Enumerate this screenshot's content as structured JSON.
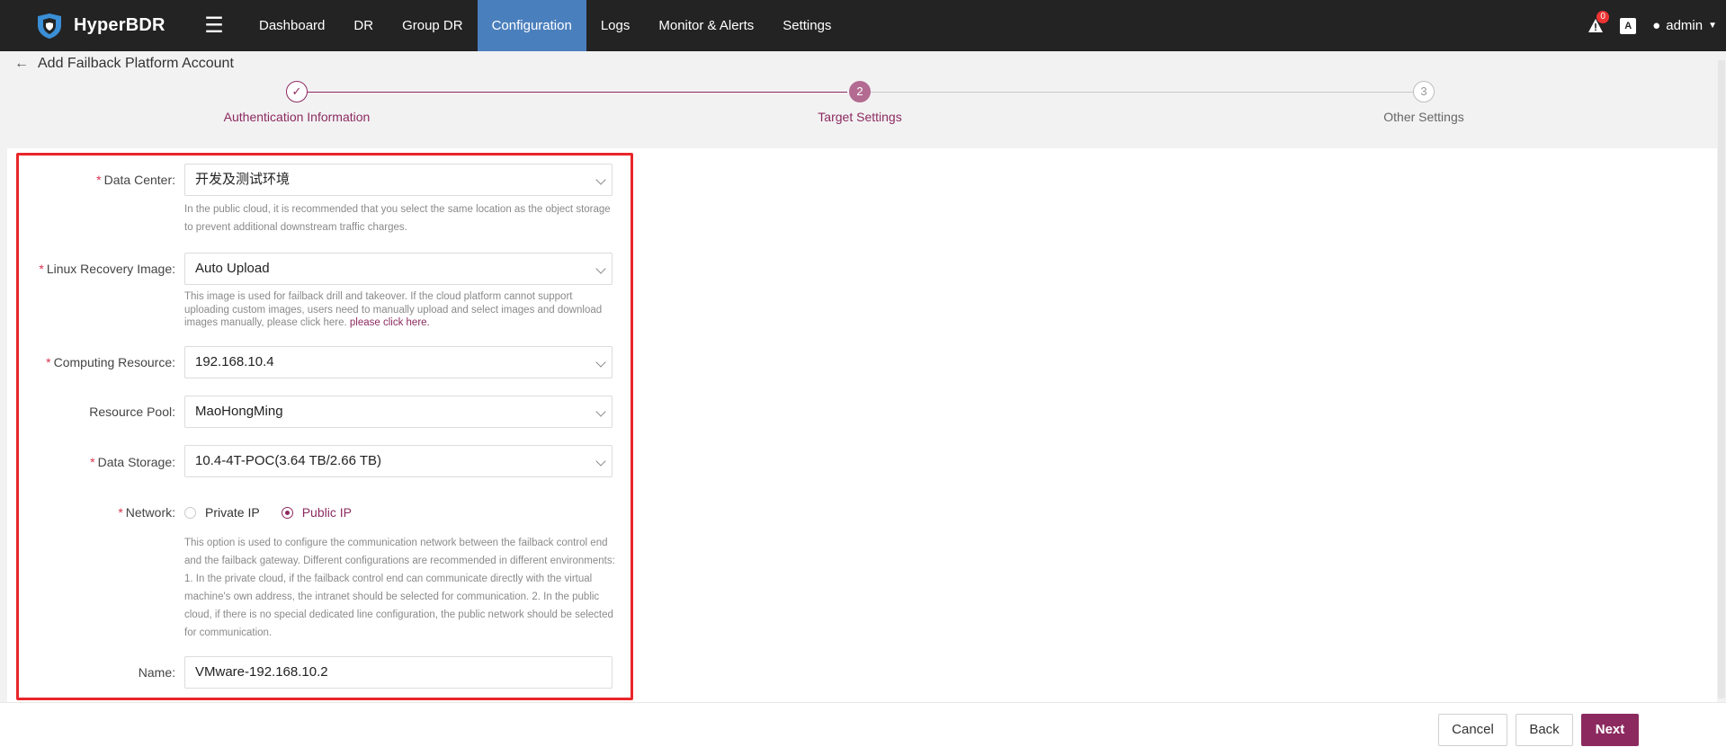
{
  "app": {
    "logo_text": "HyperBDR",
    "logo_icon": "shield-logo-icon",
    "menu_icon": "hamburger-icon"
  },
  "nav": {
    "items": [
      {
        "label": "Dashboard"
      },
      {
        "label": "DR"
      },
      {
        "label": "Group DR"
      },
      {
        "label": "Configuration",
        "active": true
      },
      {
        "label": "Logs"
      },
      {
        "label": "Monitor & Alerts"
      },
      {
        "label": "Settings"
      }
    ],
    "alerts_count": "0",
    "lang_icon_text": "A",
    "user": "admin"
  },
  "page": {
    "title": "Add Failback Platform Account"
  },
  "steps": [
    {
      "index": "1",
      "label": "Authentication Information",
      "state": "done"
    },
    {
      "index": "2",
      "label": "Target Settings",
      "state": "current"
    },
    {
      "index": "3",
      "label": "Other Settings",
      "state": "todo"
    }
  ],
  "form": {
    "data_center": {
      "label": "Data Center:",
      "required": true,
      "value": "开发及测试环境",
      "hint": "In the public cloud, it is recommended that you select the same location as the object storage to prevent additional downstream traffic charges."
    },
    "linux_image": {
      "label": "Linux Recovery Image:",
      "required": true,
      "value": "Auto Upload",
      "hint": "This image is used for failback drill and takeover. If the cloud platform cannot support uploading custom images, users need to manually upload and select images and download images manually, please click here.",
      "hint_link": "please click here."
    },
    "computing_resource": {
      "label": "Computing Resource:",
      "required": true,
      "value": "192.168.10.4"
    },
    "resource_pool": {
      "label": "Resource Pool:",
      "required": false,
      "value": "MaoHongMing"
    },
    "data_storage": {
      "label": "Data Storage:",
      "required": true,
      "value": "10.4-4T-POC(3.64 TB/2.66 TB)"
    },
    "network": {
      "label": "Network:",
      "required": true,
      "options": [
        {
          "label": "Private IP",
          "checked": false
        },
        {
          "label": "Public IP",
          "checked": true
        }
      ],
      "hint": "This option is used to configure the communication network between the failback control end and the failback gateway. Different configurations are recommended in different environments: 1. In the private cloud, if the failback control end can communicate directly with the virtual machine's own address, the intranet should be selected for communication. 2. In the public cloud, if there is no special dedicated line configuration, the public network should be selected for communication."
    },
    "name": {
      "label": "Name:",
      "required": false,
      "value": "VMware-192.168.10.2"
    }
  },
  "footer": {
    "cancel": "Cancel",
    "back": "Back",
    "next": "Next"
  },
  "colors": {
    "accent": "#8c2a5f",
    "nav_active": "#4a7fbd",
    "topbar": "#232323",
    "highlight_box": "#e8262a"
  }
}
